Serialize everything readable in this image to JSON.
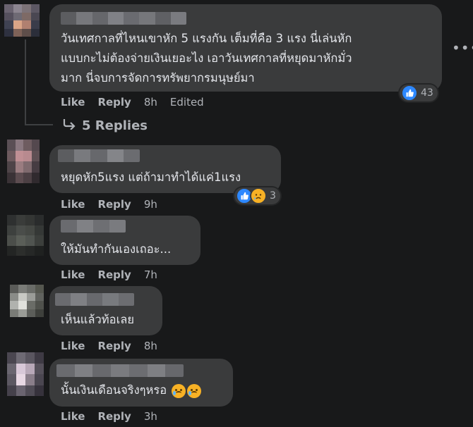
{
  "thread": {
    "replies_label": "5 Replies"
  },
  "comments": [
    {
      "lines": [
        "วันเทศกาลที่ไหนเขาหัก 5 แรงกัน เต็มที่คือ 3 แรง นี่เล่นหัก",
        "แบบกะไม่ต้องจ่ายเงินเยอะไง เอาวันเทศกาลที่หยุดมาหักมั่ว",
        "มาก นี่จบการจัดการทรัพยากรมนุษย์มา"
      ],
      "like": "Like",
      "reply": "Reply",
      "time": "8h",
      "edited": "Edited",
      "reaction_count": "43",
      "reactions": [
        "like-icon"
      ]
    },
    {
      "lines": [
        "หยุดหัก5แรง แต่ถ้ามาทำได้แค่1แรง"
      ],
      "like": "Like",
      "reply": "Reply",
      "time": "9h",
      "reaction_count": "3",
      "reactions": [
        "like-icon",
        "sad-icon"
      ]
    },
    {
      "lines": [
        "ให้มันทำกันเองเถอะ..."
      ],
      "like": "Like",
      "reply": "Reply",
      "time": "7h"
    },
    {
      "lines": [
        "เห็นแล้วท้อเลย"
      ],
      "like": "Like",
      "reply": "Reply",
      "time": "8h"
    },
    {
      "lines": [
        "นั้นเงินเดือนจริงๆหรอ"
      ],
      "like": "Like",
      "reply": "Reply",
      "time": "3h",
      "trailing_emojis": [
        "crying-face-emoji",
        "crying-face-emoji"
      ]
    }
  ],
  "menu": {
    "more_label": "•••"
  },
  "colors": {
    "background": "#18191a",
    "bubble": "#3a3b3c",
    "text": "#e4e6eb",
    "secondary": "#b0b3b8",
    "like_blue": "#2d88ff",
    "sad_yellow": "#f7b125"
  }
}
